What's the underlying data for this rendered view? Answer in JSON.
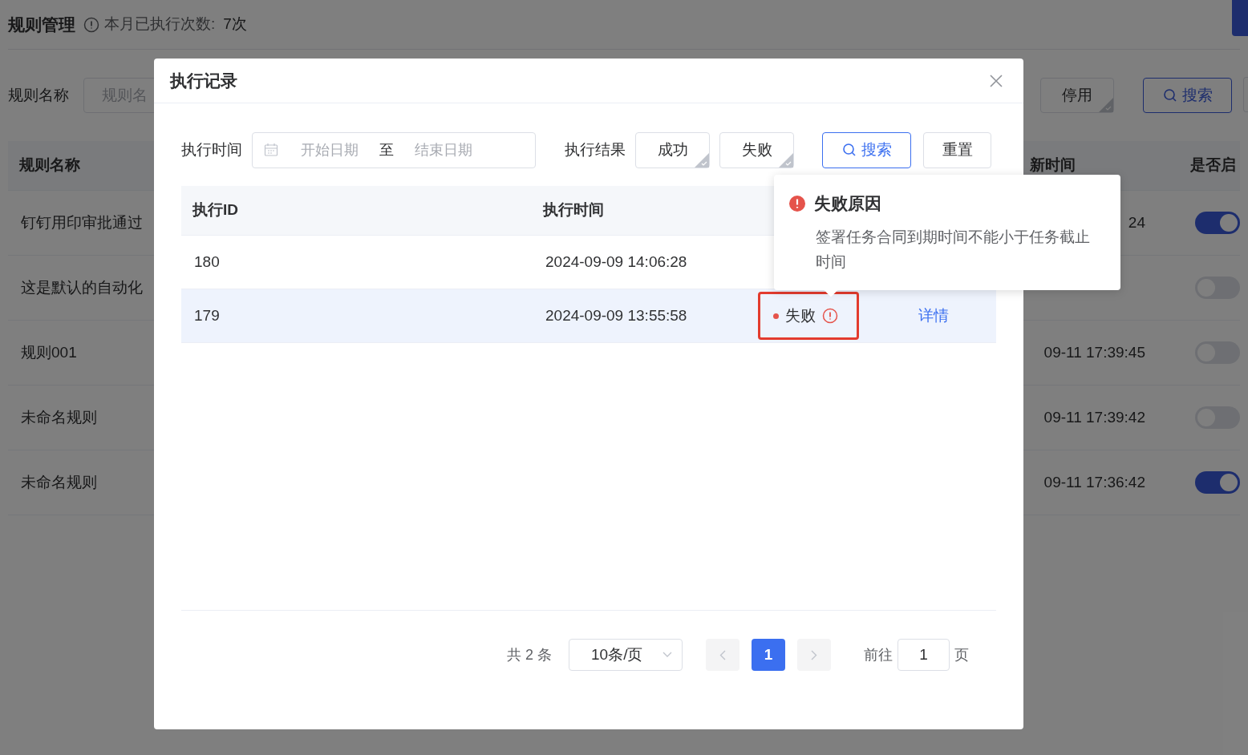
{
  "page": {
    "title": "规则管理",
    "usage_label": "本月已执行次数:",
    "usage_value": "7次",
    "filter": {
      "label": "规则名称",
      "placeholder": "规则名",
      "buttons": [
        {
          "label": "停用",
          "kind": "check"
        },
        {
          "label": "搜索",
          "kind": "search"
        }
      ]
    },
    "table": {
      "columns": [
        "规则名称",
        "新时间",
        "是否启"
      ],
      "rows": [
        {
          "name": "钉钉用印审批通过",
          "time": "24",
          "enabled": true
        },
        {
          "name": "这是默认的自动化",
          "enabled": false
        },
        {
          "name": "规则001",
          "time": "09-11 17:39:45",
          "enabled": false
        },
        {
          "name": "未命名规则",
          "time": "09-11 17:39:42",
          "enabled": false
        },
        {
          "name": "未命名规则",
          "time": "09-11 17:36:42",
          "enabled": true
        }
      ]
    }
  },
  "dialog": {
    "title": "执行记录",
    "filter": {
      "time_label": "执行时间",
      "start_placeholder": "开始日期",
      "separator": "至",
      "end_placeholder": "结束日期",
      "result_label": "执行结果",
      "results": [
        {
          "label": "成功",
          "selected": false
        },
        {
          "label": "失败",
          "selected": false
        }
      ],
      "search": "搜索",
      "reset": "重置"
    },
    "table": {
      "columns": [
        "执行ID",
        "执行时间"
      ],
      "rows": [
        {
          "id": "180",
          "time": "2024-09-09 14:06:28",
          "hovered": false
        },
        {
          "id": "179",
          "time": "2024-09-09 13:55:58",
          "hovered": true,
          "status": {
            "text": "失败",
            "kind": "failed"
          },
          "action": "详情"
        }
      ]
    },
    "pagination": {
      "total": "共 2 条",
      "page_size": "10条/页",
      "pages": [
        {
          "label": "1",
          "selected": true
        }
      ],
      "goto_label": "前往",
      "goto_value": "1",
      "goto_suffix": "页"
    }
  },
  "tooltip": {
    "title": "失败原因",
    "text": "签署任务合同到期时间不能小于任务截止时间"
  }
}
